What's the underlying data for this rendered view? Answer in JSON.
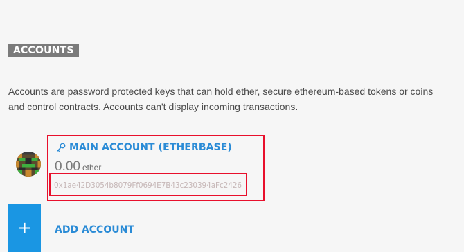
{
  "accounts_section": {
    "heading": "ACCOUNTS",
    "description_line1": "Accounts are password protected keys that can hold ether, secure ethereum-based tokens or coins",
    "description_line2": "and control contracts. Accounts can't display incoming transactions."
  },
  "main_account": {
    "icon": "key-icon",
    "name": "MAIN ACCOUNT (ETHERBASE)",
    "balance": "0.00",
    "unit": "ether",
    "address": "0x1ae42D3054b8079Ff0694E7B43c230394aFc2426"
  },
  "add_account": {
    "icon": "plus-icon",
    "icon_glyph": "+",
    "label": "ADD ACCOUNT"
  },
  "colors": {
    "accent": "#2a8bd6",
    "highlight": "#e8102c",
    "add_button": "#1a96e3"
  }
}
